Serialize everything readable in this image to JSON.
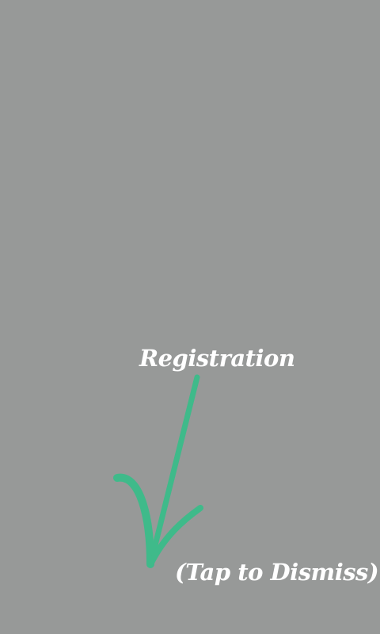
{
  "overlay": {
    "background_color": "#979998",
    "accent_color": "#3fba8a"
  },
  "hint": {
    "label": "Registration",
    "icon": "curved-arrow-down-left-icon"
  },
  "dismiss": {
    "label": "(Tap to Dismiss)"
  }
}
